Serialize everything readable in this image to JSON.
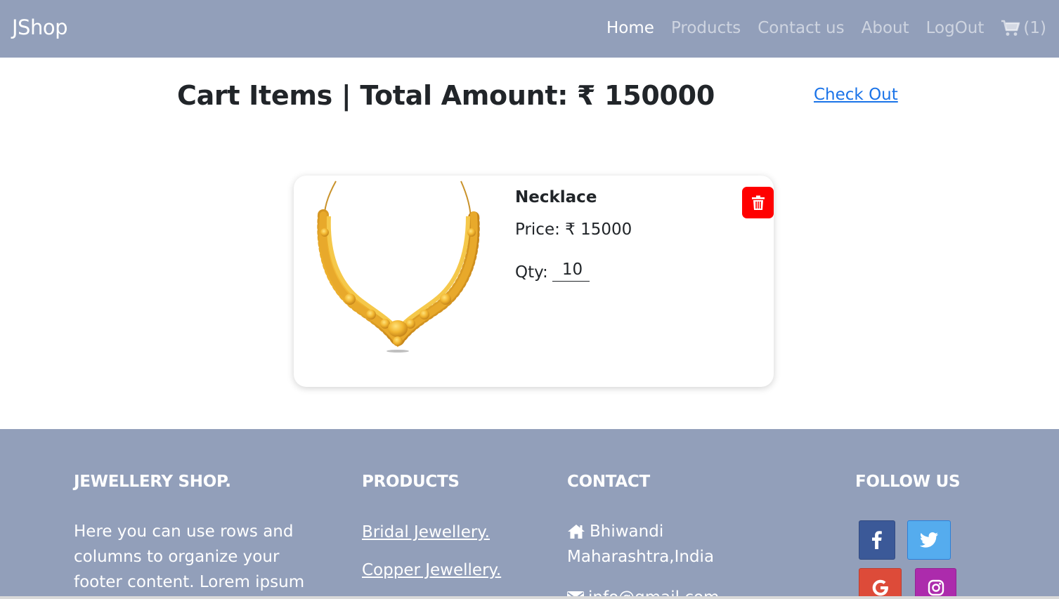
{
  "navbar": {
    "brand": "JShop",
    "links": [
      "Home",
      "Products",
      "Contact us",
      "About",
      "LogOut"
    ],
    "active_link": "Home",
    "cart_count_label": "(1)"
  },
  "cart": {
    "title": "Cart Items | Total Amount: ₹ 150000",
    "checkout_label": "Check Out",
    "items": [
      {
        "name": "Necklace",
        "price_label": "Price: ₹ 15000",
        "qty_label": "Qty:",
        "qty_value": "10"
      }
    ]
  },
  "footer": {
    "about": {
      "heading": "JEWELLERY SHOP.",
      "text": "Here you can use rows and columns to organize your footer content. Lorem ipsum"
    },
    "products": {
      "heading": "PRODUCTS",
      "links": [
        "Bridal Jewellery.",
        "Copper Jewellery."
      ]
    },
    "contact": {
      "heading": "CONTACT",
      "address_line1": "Bhiwandi",
      "address_line2": "Maharashtra,India",
      "email": "info@gmail.com"
    },
    "follow": {
      "heading": "FOLLOW US",
      "icons": [
        "facebook-icon",
        "twitter-icon",
        "google-icon",
        "instagram-icon"
      ]
    }
  },
  "colors": {
    "navbar_bg": "#929fba",
    "delete_button": "#ff0000",
    "link": "#1a73e8",
    "facebook": "#3b5998",
    "twitter": "#55acee",
    "google": "#dd4b39",
    "instagram": "#ac2bac"
  }
}
